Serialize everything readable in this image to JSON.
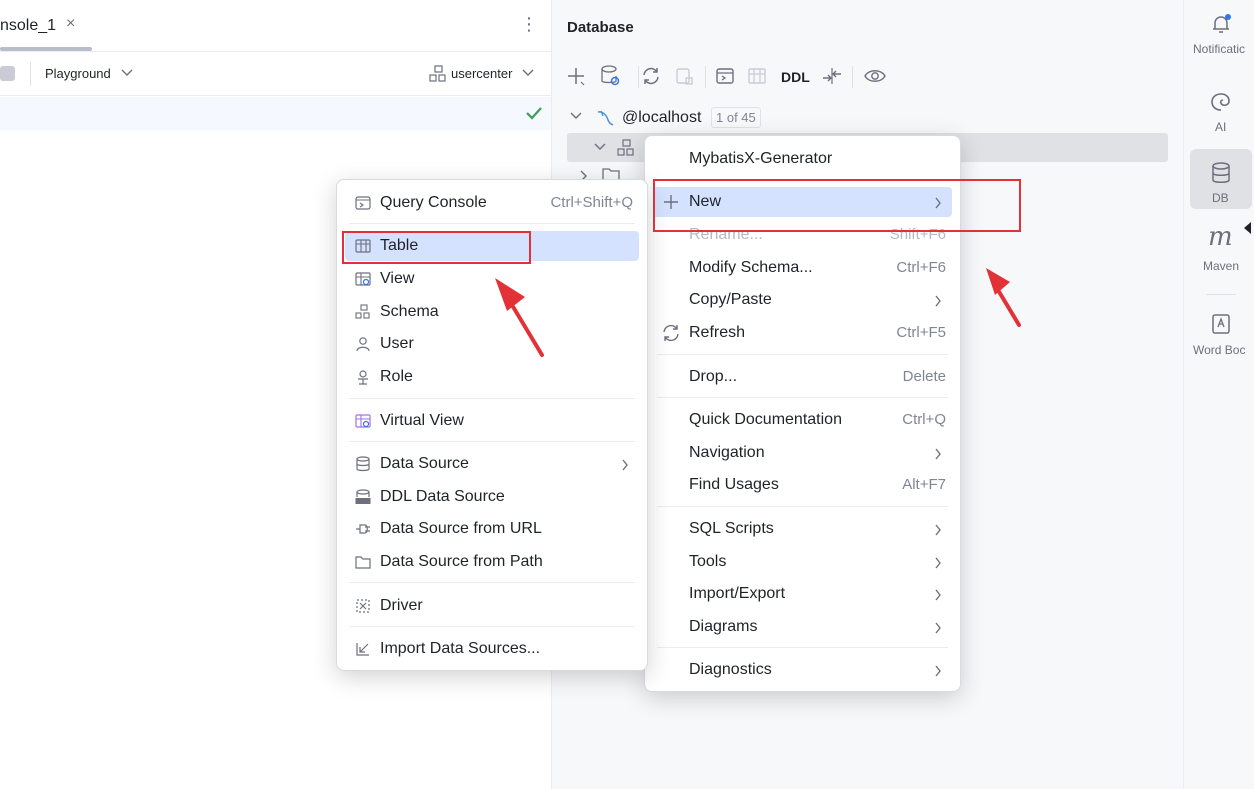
{
  "editor": {
    "tab_label": "nsole_1",
    "close_glyph": "×",
    "more_glyph": "⋮",
    "playground_label": "Playground",
    "schema_label": "usercenter"
  },
  "database": {
    "title": "Database",
    "ddl_label": "DDL",
    "host_label": "@localhost",
    "count_badge": "1 of 45"
  },
  "strip": {
    "notifications": "Notificatic",
    "ai": "AI",
    "db": "DB",
    "maven": "Maven",
    "maven_glyph": "m",
    "word_book": "Word Boc"
  },
  "context_menu": {
    "mybatisx": "MybatisX-Generator",
    "new": "New",
    "rename": "Rename...",
    "rename_shortcut": "Shift+F6",
    "modify_schema": "Modify Schema...",
    "modify_schema_shortcut": "Ctrl+F6",
    "copy_paste": "Copy/Paste",
    "refresh": "Refresh",
    "refresh_shortcut": "Ctrl+F5",
    "drop": "Drop...",
    "drop_shortcut": "Delete",
    "quick_documentation": "Quick Documentation",
    "quick_documentation_shortcut": "Ctrl+Q",
    "navigation": "Navigation",
    "find_usages": "Find Usages",
    "find_usages_shortcut": "Alt+F7",
    "sql_scripts": "SQL Scripts",
    "tools": "Tools",
    "import_export": "Import/Export",
    "diagrams": "Diagrams",
    "diagnostics": "Diagnostics"
  },
  "new_submenu": {
    "query_console": "Query Console",
    "query_console_shortcut": "Ctrl+Shift+Q",
    "table": "Table",
    "view": "View",
    "schema": "Schema",
    "user": "User",
    "role": "Role",
    "virtual_view": "Virtual View",
    "data_source": "Data Source",
    "ddl_data_source": "DDL Data Source",
    "data_source_url": "Data Source from URL",
    "data_source_path": "Data Source from Path",
    "driver": "Driver",
    "import_data_sources": "Import Data Sources..."
  },
  "colors": {
    "highlight": "#d4e2ff",
    "annotation_red": "#e23238",
    "panel_bg": "#f7f8fa",
    "check_green": "#3a9f55"
  },
  "icons": [
    "close-icon",
    "more-icon",
    "chevron-down-icon",
    "schema-icon",
    "checkmark-icon",
    "add-icon",
    "datasource-settings-icon",
    "refresh-icon",
    "disconnect-icon",
    "console-icon",
    "table-icon",
    "compare-icon",
    "eye-icon",
    "mysql-icon",
    "folder-icon",
    "bell-icon",
    "ai-icon",
    "database-icon",
    "maven-icon",
    "word-book-icon",
    "plus-icon",
    "chevron-right-icon",
    "view-icon",
    "user-icon",
    "role-icon",
    "virtual-view-icon",
    "ddl-icon",
    "url-icon",
    "driver-icon",
    "import-icon"
  ]
}
